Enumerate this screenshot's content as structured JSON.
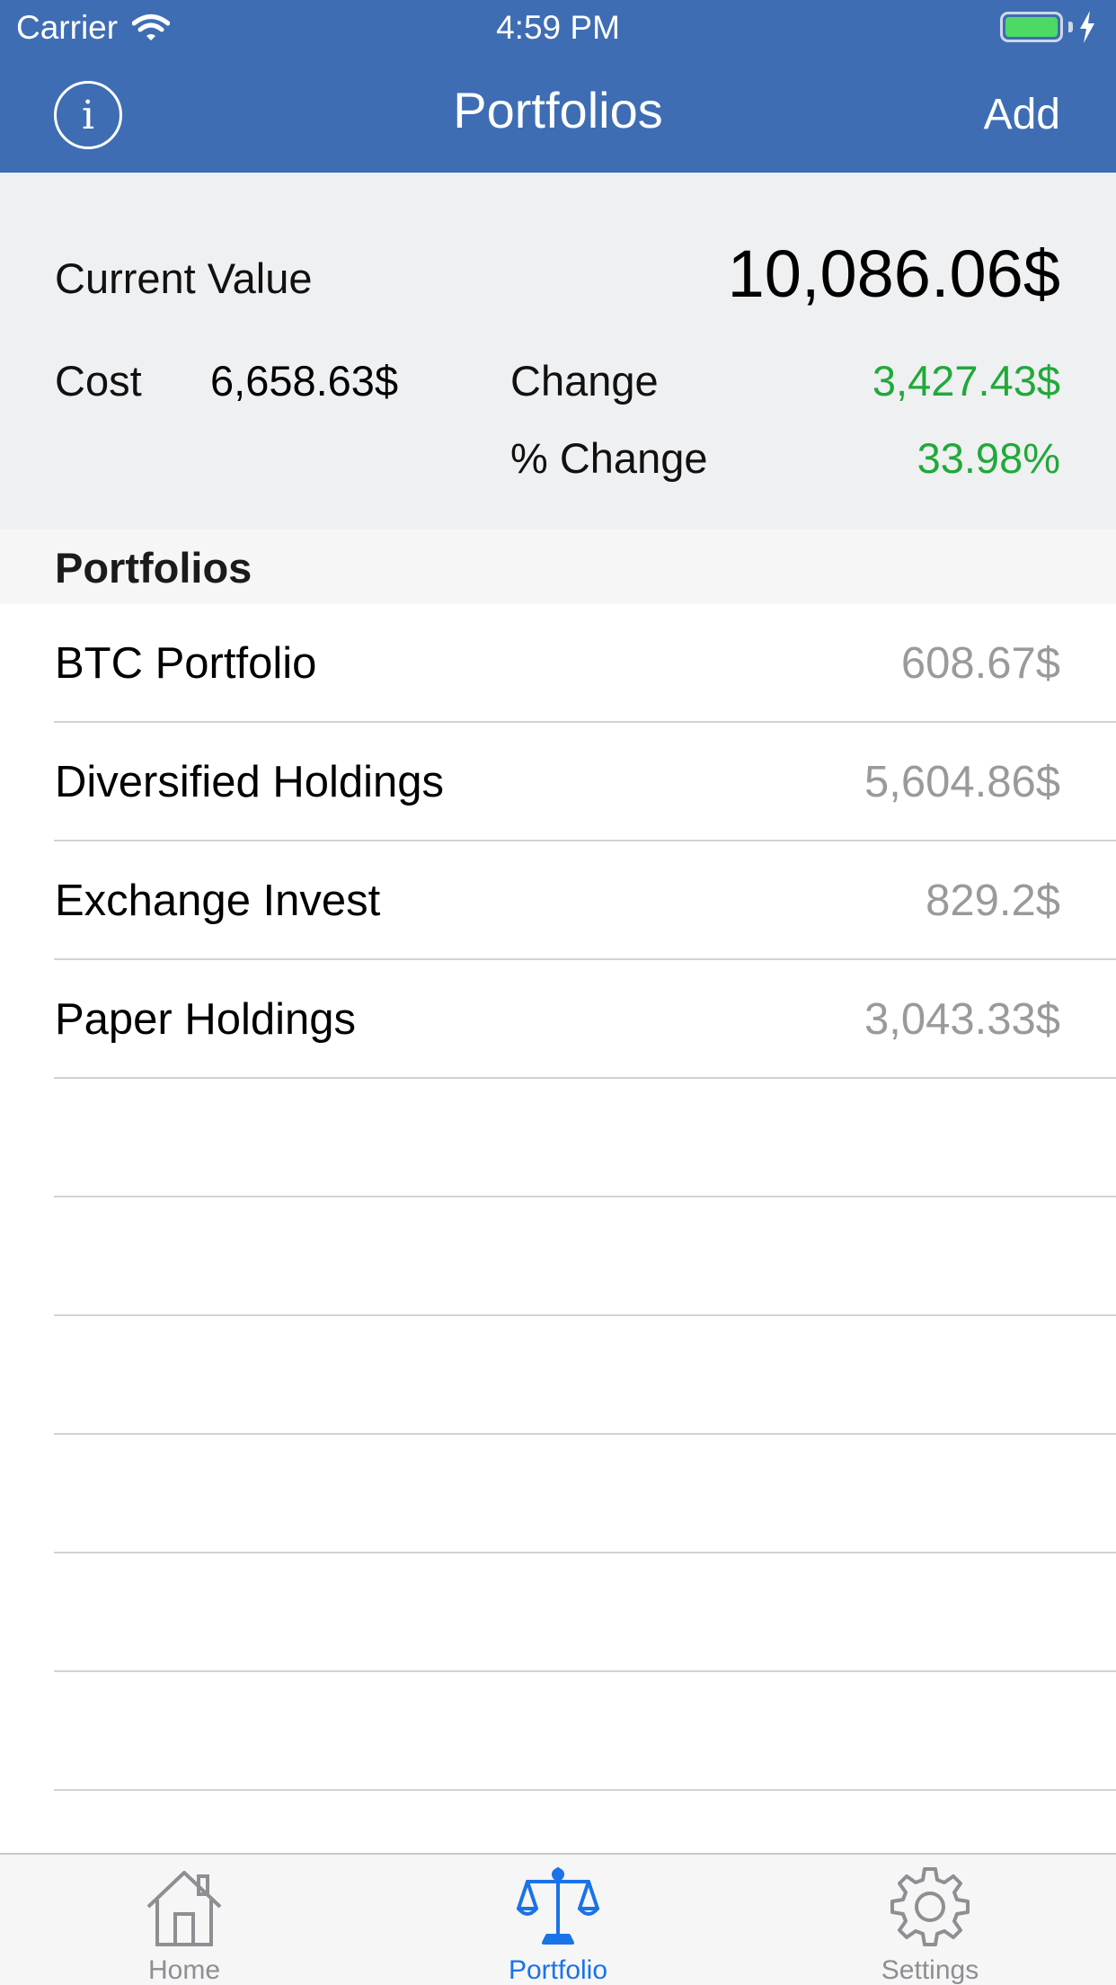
{
  "status_bar": {
    "carrier": "Carrier",
    "time": "4:59 PM"
  },
  "nav": {
    "title": "Portfolios",
    "add_label": "Add",
    "info_label": "i"
  },
  "summary": {
    "current_value_label": "Current Value",
    "current_value": "10,086.06$",
    "cost_label": "Cost",
    "cost": "6,658.63$",
    "change_label": "Change",
    "change": "3,427.43$",
    "pct_change_label": "% Change",
    "pct_change": "33.98%"
  },
  "section_title": "Portfolios",
  "portfolios": [
    {
      "name": "BTC Portfolio",
      "value": "608.67$"
    },
    {
      "name": "Diversified Holdings",
      "value": "5,604.86$"
    },
    {
      "name": "Exchange Invest",
      "value": "829.2$"
    },
    {
      "name": "Paper Holdings",
      "value": "3,043.33$"
    }
  ],
  "tabs": [
    {
      "label": "Home",
      "icon": "house-icon"
    },
    {
      "label": "Portfolio",
      "icon": "scale-icon",
      "active": true
    },
    {
      "label": "Settings",
      "icon": "gear-icon"
    }
  ],
  "colors": {
    "nav": "#3e6db4",
    "positive": "#21a93a",
    "active_tab": "#1a73e8"
  }
}
